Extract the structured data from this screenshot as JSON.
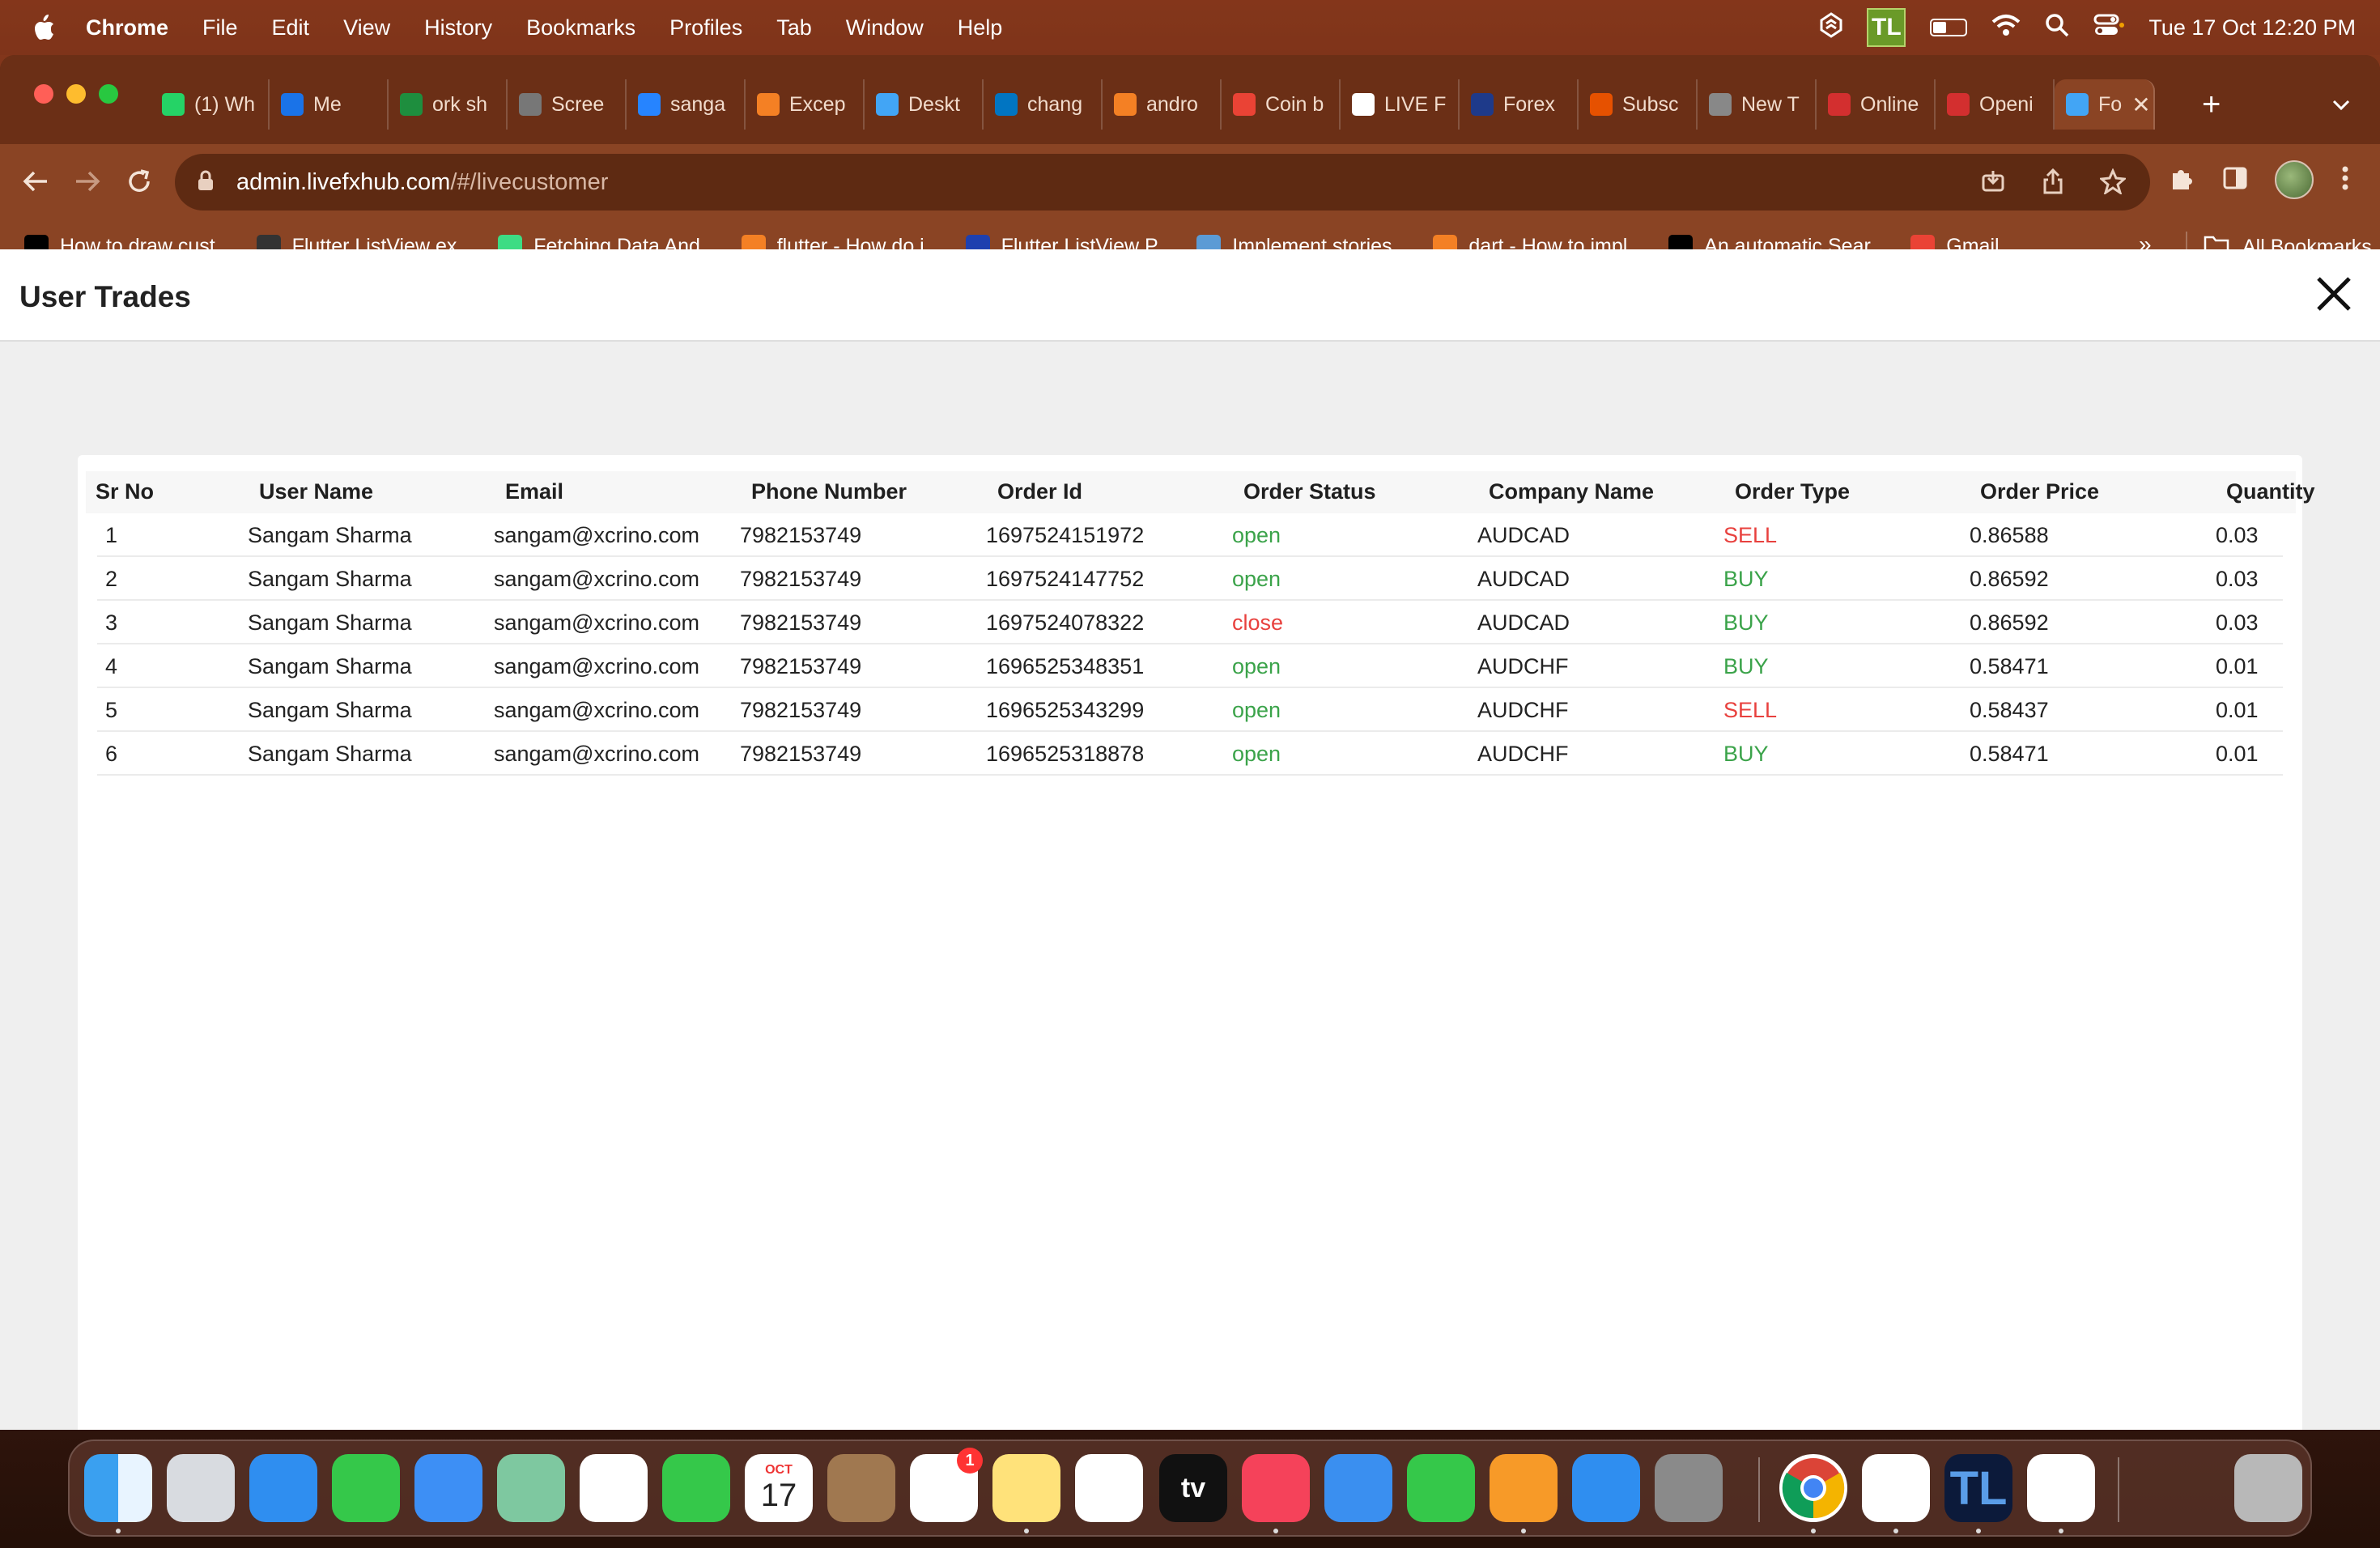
{
  "menubar": {
    "app": "Chrome",
    "items": [
      "File",
      "Edit",
      "View",
      "History",
      "Bookmarks",
      "Profiles",
      "Tab",
      "Window",
      "Help"
    ],
    "tl_badge": "TL",
    "clock": "Tue 17 Oct  12:20 PM"
  },
  "tabs": [
    {
      "label": "(1) Wh",
      "icon": "whatsapp-icon",
      "color": "#25d366"
    },
    {
      "label": "Me",
      "icon": "google-meet-icon",
      "color": "#1a73e8"
    },
    {
      "label": "ork sh",
      "icon": "google-sheets-icon",
      "color": "#1e8e3e"
    },
    {
      "label": "Scree",
      "icon": "globe-icon",
      "color": "#777777"
    },
    {
      "label": "sanga",
      "icon": "jira-icon",
      "color": "#2684ff"
    },
    {
      "label": "Excep",
      "icon": "stackoverflow-icon",
      "color": "#f48024"
    },
    {
      "label": "Deskt",
      "icon": "flutter-icon",
      "color": "#42a5f5"
    },
    {
      "label": "chang",
      "icon": "dart-icon",
      "color": "#0175c2"
    },
    {
      "label": "andro",
      "icon": "stackoverflow-icon",
      "color": "#f48024"
    },
    {
      "label": "Coin b",
      "icon": "gmail-icon",
      "color": "#ea4335"
    },
    {
      "label": "LIVE F",
      "icon": "page-icon",
      "color": "#ffffff"
    },
    {
      "label": "Forex",
      "icon": "forex-icon",
      "color": "#1e3a8a"
    },
    {
      "label": "Subsc",
      "icon": "dfx-icon",
      "color": "#e65100"
    },
    {
      "label": "New T",
      "icon": "chrome-icon",
      "color": "#888888"
    },
    {
      "label": "Online",
      "icon": "fx-icon",
      "color": "#d32f2f"
    },
    {
      "label": "Openi",
      "icon": "fx-icon",
      "color": "#d32f2f"
    },
    {
      "label": "Fo",
      "icon": "flutter-icon",
      "color": "#42a5f5",
      "active": true
    }
  ],
  "tab_active_close": "✕",
  "new_tab": "+",
  "address": {
    "host": "admin.livefxhub.com",
    "path": "/#/livecustomer"
  },
  "bookmarks": [
    {
      "label": "How to draw cust...",
      "icon": "medium-icon",
      "color": "#000000"
    },
    {
      "label": "Flutter ListView ex...",
      "icon": "globe-icon",
      "color": "#333333"
    },
    {
      "label": "Fetching Data And...",
      "icon": "android-icon",
      "color": "#3ddc84"
    },
    {
      "label": "flutter - How do i...",
      "icon": "stackoverflow-icon",
      "color": "#f48024"
    },
    {
      "label": "Flutter ListView P...",
      "icon": "s-icon",
      "color": "#1e40af"
    },
    {
      "label": "Implement stories...",
      "icon": "puzzle-icon",
      "color": "#5b9bd5"
    },
    {
      "label": "dart - How to impl...",
      "icon": "stackoverflow-icon",
      "color": "#f48024"
    },
    {
      "label": "An automatic Sear...",
      "icon": "medium-m-icon",
      "color": "#000000"
    },
    {
      "label": "Gmail",
      "icon": "gmail-icon",
      "color": "#ea4335"
    }
  ],
  "bookmarks_more": "»",
  "all_bookmarks": "All Bookmarks",
  "dialog": {
    "title": "User Trades"
  },
  "table": {
    "columns": [
      "Sr No",
      "User Name",
      "Email",
      "Phone Number",
      "Order Id",
      "Order Status",
      "Company Name",
      "Order Type",
      "Order Price",
      "Quantity"
    ],
    "rows": [
      {
        "sr": "1",
        "name": "Sangam Sharma",
        "email": "sangam@xcrino.com",
        "phone": "7982153749",
        "order_id": "1697524151972",
        "status": "open",
        "company": "AUDCAD",
        "type": "SELL",
        "price": "0.86588",
        "qty": "0.03"
      },
      {
        "sr": "2",
        "name": "Sangam Sharma",
        "email": "sangam@xcrino.com",
        "phone": "7982153749",
        "order_id": "1697524147752",
        "status": "open",
        "company": "AUDCAD",
        "type": "BUY",
        "price": "0.86592",
        "qty": "0.03"
      },
      {
        "sr": "3",
        "name": "Sangam Sharma",
        "email": "sangam@xcrino.com",
        "phone": "7982153749",
        "order_id": "1697524078322",
        "status": "close",
        "company": "AUDCAD",
        "type": "BUY",
        "price": "0.86592",
        "qty": "0.03"
      },
      {
        "sr": "4",
        "name": "Sangam Sharma",
        "email": "sangam@xcrino.com",
        "phone": "7982153749",
        "order_id": "1696525348351",
        "status": "open",
        "company": "AUDCHF",
        "type": "BUY",
        "price": "0.58471",
        "qty": "0.01"
      },
      {
        "sr": "5",
        "name": "Sangam Sharma",
        "email": "sangam@xcrino.com",
        "phone": "7982153749",
        "order_id": "1696525343299",
        "status": "open",
        "company": "AUDCHF",
        "type": "SELL",
        "price": "0.58437",
        "qty": "0.01"
      },
      {
        "sr": "6",
        "name": "Sangam Sharma",
        "email": "sangam@xcrino.com",
        "phone": "7982153749",
        "order_id": "1696525318878",
        "status": "open",
        "company": "AUDCHF",
        "type": "BUY",
        "price": "0.58471",
        "qty": "0.01"
      }
    ]
  },
  "colors": {
    "positive": "#3ba34a",
    "negative": "#e8413e"
  },
  "dock": {
    "calendar_month": "OCT",
    "calendar_day": "17",
    "reminders_badge": "1",
    "tv_label": "tv",
    "tl_label": "TL",
    "apps": [
      "finder-icon",
      "launchpad-icon",
      "safari-icon",
      "messages-icon",
      "mail-icon",
      "maps-icon",
      "photos-icon",
      "facetime-icon",
      "calendar-icon",
      "contacts-icon",
      "reminders-icon",
      "notes-icon",
      "freeform-icon",
      "apple-tv-icon",
      "music-icon",
      "keynote-icon",
      "numbers-icon",
      "pages-icon",
      "app-store-icon",
      "system-settings-icon",
      "chrome-icon",
      "xcode-icon",
      "tl-app-icon",
      "simulator-icon",
      "downloads-stack-icon",
      "trash-icon"
    ]
  }
}
